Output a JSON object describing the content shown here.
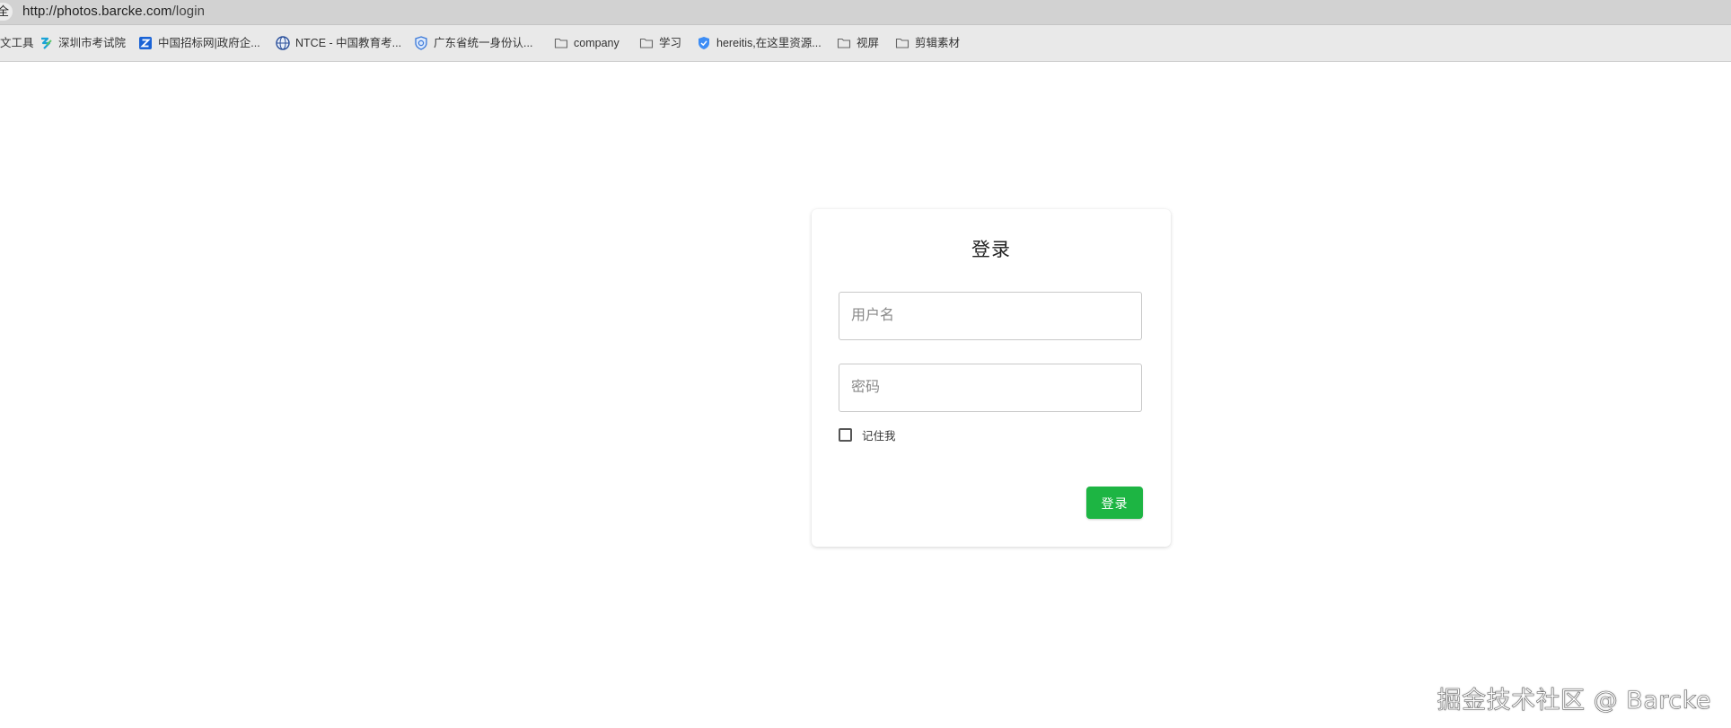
{
  "browser": {
    "lock_glyph": "全",
    "url_host": "http://photos.barcke.com",
    "url_path": "/login"
  },
  "bookmarks": [
    {
      "label": "文工具",
      "icon": "none-icon"
    },
    {
      "label": "深圳市考试院",
      "icon": "sz-exam-icon"
    },
    {
      "label": "中国招标网|政府企...",
      "icon": "zbw-icon"
    },
    {
      "label": "NTCE - 中国教育考...",
      "icon": "globe-icon"
    },
    {
      "label": "广东省统一身份认...",
      "icon": "shield-icon"
    },
    {
      "label": "company",
      "icon": "folder-icon"
    },
    {
      "label": "学习",
      "icon": "folder-icon"
    },
    {
      "label": "hereitis,在这里资源...",
      "icon": "shield-blue-icon"
    },
    {
      "label": "视屏",
      "icon": "folder-icon"
    },
    {
      "label": "剪辑素材",
      "icon": "folder-icon"
    }
  ],
  "login": {
    "title": "登录",
    "username_placeholder": "用户名",
    "password_placeholder": "密码",
    "remember_label": "记住我",
    "submit_label": "登录"
  },
  "watermark": "掘金技术社区 @ Barcke",
  "colors": {
    "primary_button": "#1db543",
    "address_bar": "#d2d2d2",
    "bookmarks_bar": "#e9e9e9"
  }
}
